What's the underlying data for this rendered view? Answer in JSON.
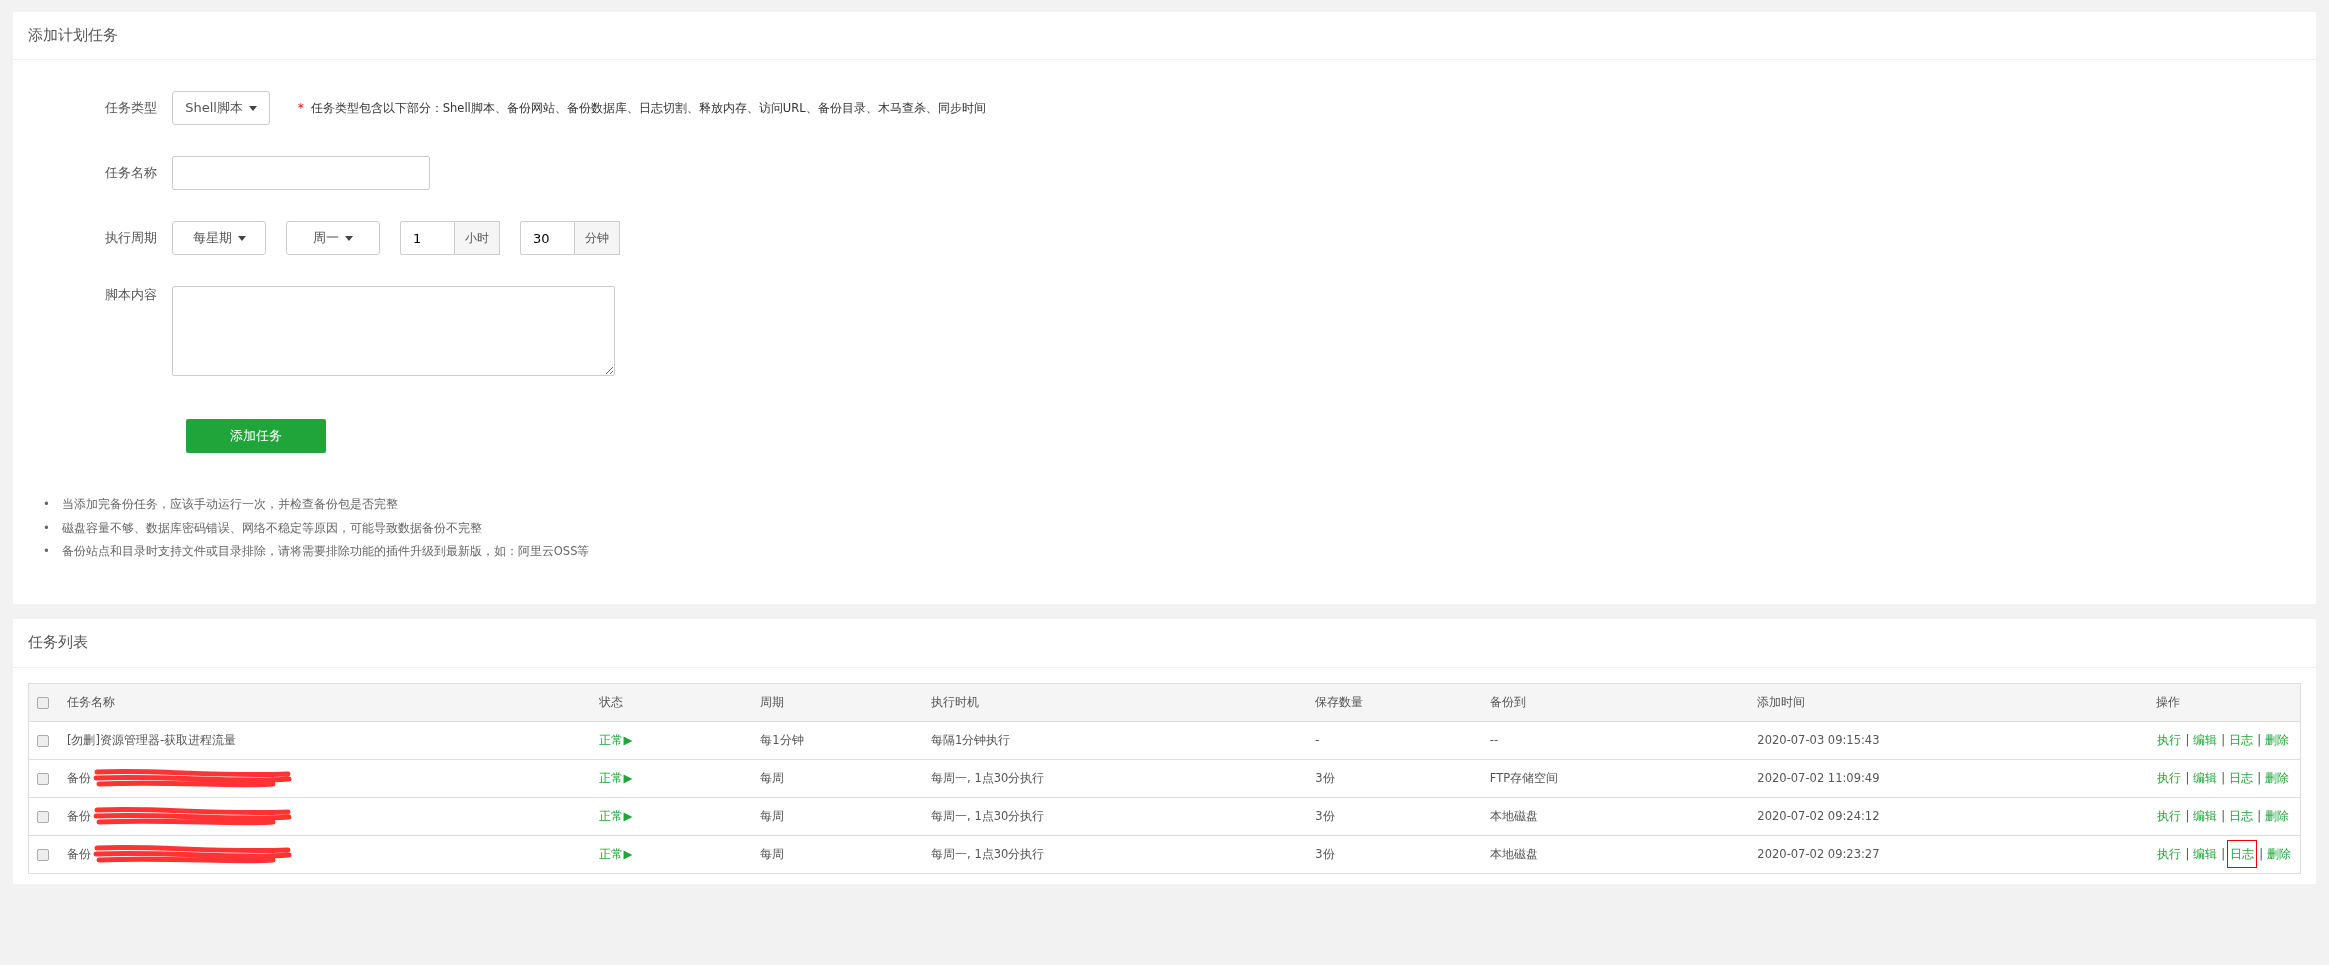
{
  "form_card": {
    "title": "添加计划任务",
    "task_type": {
      "label": "任务类型",
      "value": "Shell脚本",
      "hint_mark": "*",
      "hint": "任务类型包含以下部分：Shell脚本、备份网站、备份数据库、日志切割、释放内存、访问URL、备份目录、木马查杀、同步时间"
    },
    "task_name": {
      "label": "任务名称"
    },
    "period": {
      "label": "执行周期",
      "cycle": "每星期",
      "weekday": "周一",
      "hour": "1",
      "hour_unit": "小时",
      "minute": "30",
      "minute_unit": "分钟"
    },
    "script": {
      "label": "脚本内容"
    },
    "submit": "添加任务",
    "notes": [
      {
        "bullet": "•",
        "text": "当添加完备份任务，应该手动运行一次，并检查备份包是否完整"
      },
      {
        "bullet": "•",
        "text": "磁盘容量不够、数据库密码错误、网络不稳定等原因，可能导致数据备份不完整"
      },
      {
        "bullet": "•",
        "text": "备份站点和目录时支持文件或目录排除，请将需要排除功能的插件升级到最新版，如：阿里云OSS等"
      }
    ]
  },
  "list_card": {
    "title": "任务列表",
    "table": {
      "select_all_checked": false,
      "columns": [
        "任务名称",
        "状态",
        "周期",
        "执行时机",
        "保存数量",
        "备份到",
        "添加时间",
        "操作"
      ],
      "rows": [
        {
          "checked": false,
          "name": "[勿删]资源管理器-获取进程流量",
          "redacted": false,
          "status": "正常▶",
          "period": "每1分钟",
          "timing": "每隔1分钟执行",
          "keep": "-",
          "target": "--",
          "added": "2020-07-03 09:15:43",
          "separator": "|",
          "actions": [
            {
              "label": "执行",
              "highlighted": false
            },
            {
              "label": "编辑",
              "highlighted": false
            },
            {
              "label": "日志",
              "highlighted": false
            },
            {
              "label": "删除",
              "highlighted": false
            }
          ]
        },
        {
          "checked": false,
          "name": "备份",
          "redacted": true,
          "status": "正常▶",
          "period": "每周",
          "timing": "每周一, 1点30分执行",
          "keep": "3份",
          "target": "FTP存储空间",
          "added": "2020-07-02 11:09:49",
          "separator": "|",
          "actions": [
            {
              "label": "执行",
              "highlighted": false
            },
            {
              "label": "编辑",
              "highlighted": false
            },
            {
              "label": "日志",
              "highlighted": false
            },
            {
              "label": "删除",
              "highlighted": false
            }
          ]
        },
        {
          "checked": false,
          "name": "备份",
          "redacted": true,
          "status": "正常▶",
          "period": "每周",
          "timing": "每周一, 1点30分执行",
          "keep": "3份",
          "target": "本地磁盘",
          "added": "2020-07-02 09:24:12",
          "separator": "|",
          "actions": [
            {
              "label": "执行",
              "highlighted": false
            },
            {
              "label": "编辑",
              "highlighted": false
            },
            {
              "label": "日志",
              "highlighted": false
            },
            {
              "label": "删除",
              "highlighted": false
            }
          ]
        },
        {
          "checked": false,
          "name": "备份",
          "redacted": true,
          "status": "正常▶",
          "period": "每周",
          "timing": "每周一, 1点30分执行",
          "keep": "3份",
          "target": "本地磁盘",
          "added": "2020-07-02 09:23:27",
          "separator": "|",
          "actions": [
            {
              "label": "执行",
              "highlighted": false
            },
            {
              "label": "编辑",
              "highlighted": false
            },
            {
              "label": "日志",
              "highlighted": true
            },
            {
              "label": "删除",
              "highlighted": false
            }
          ]
        }
      ]
    }
  }
}
